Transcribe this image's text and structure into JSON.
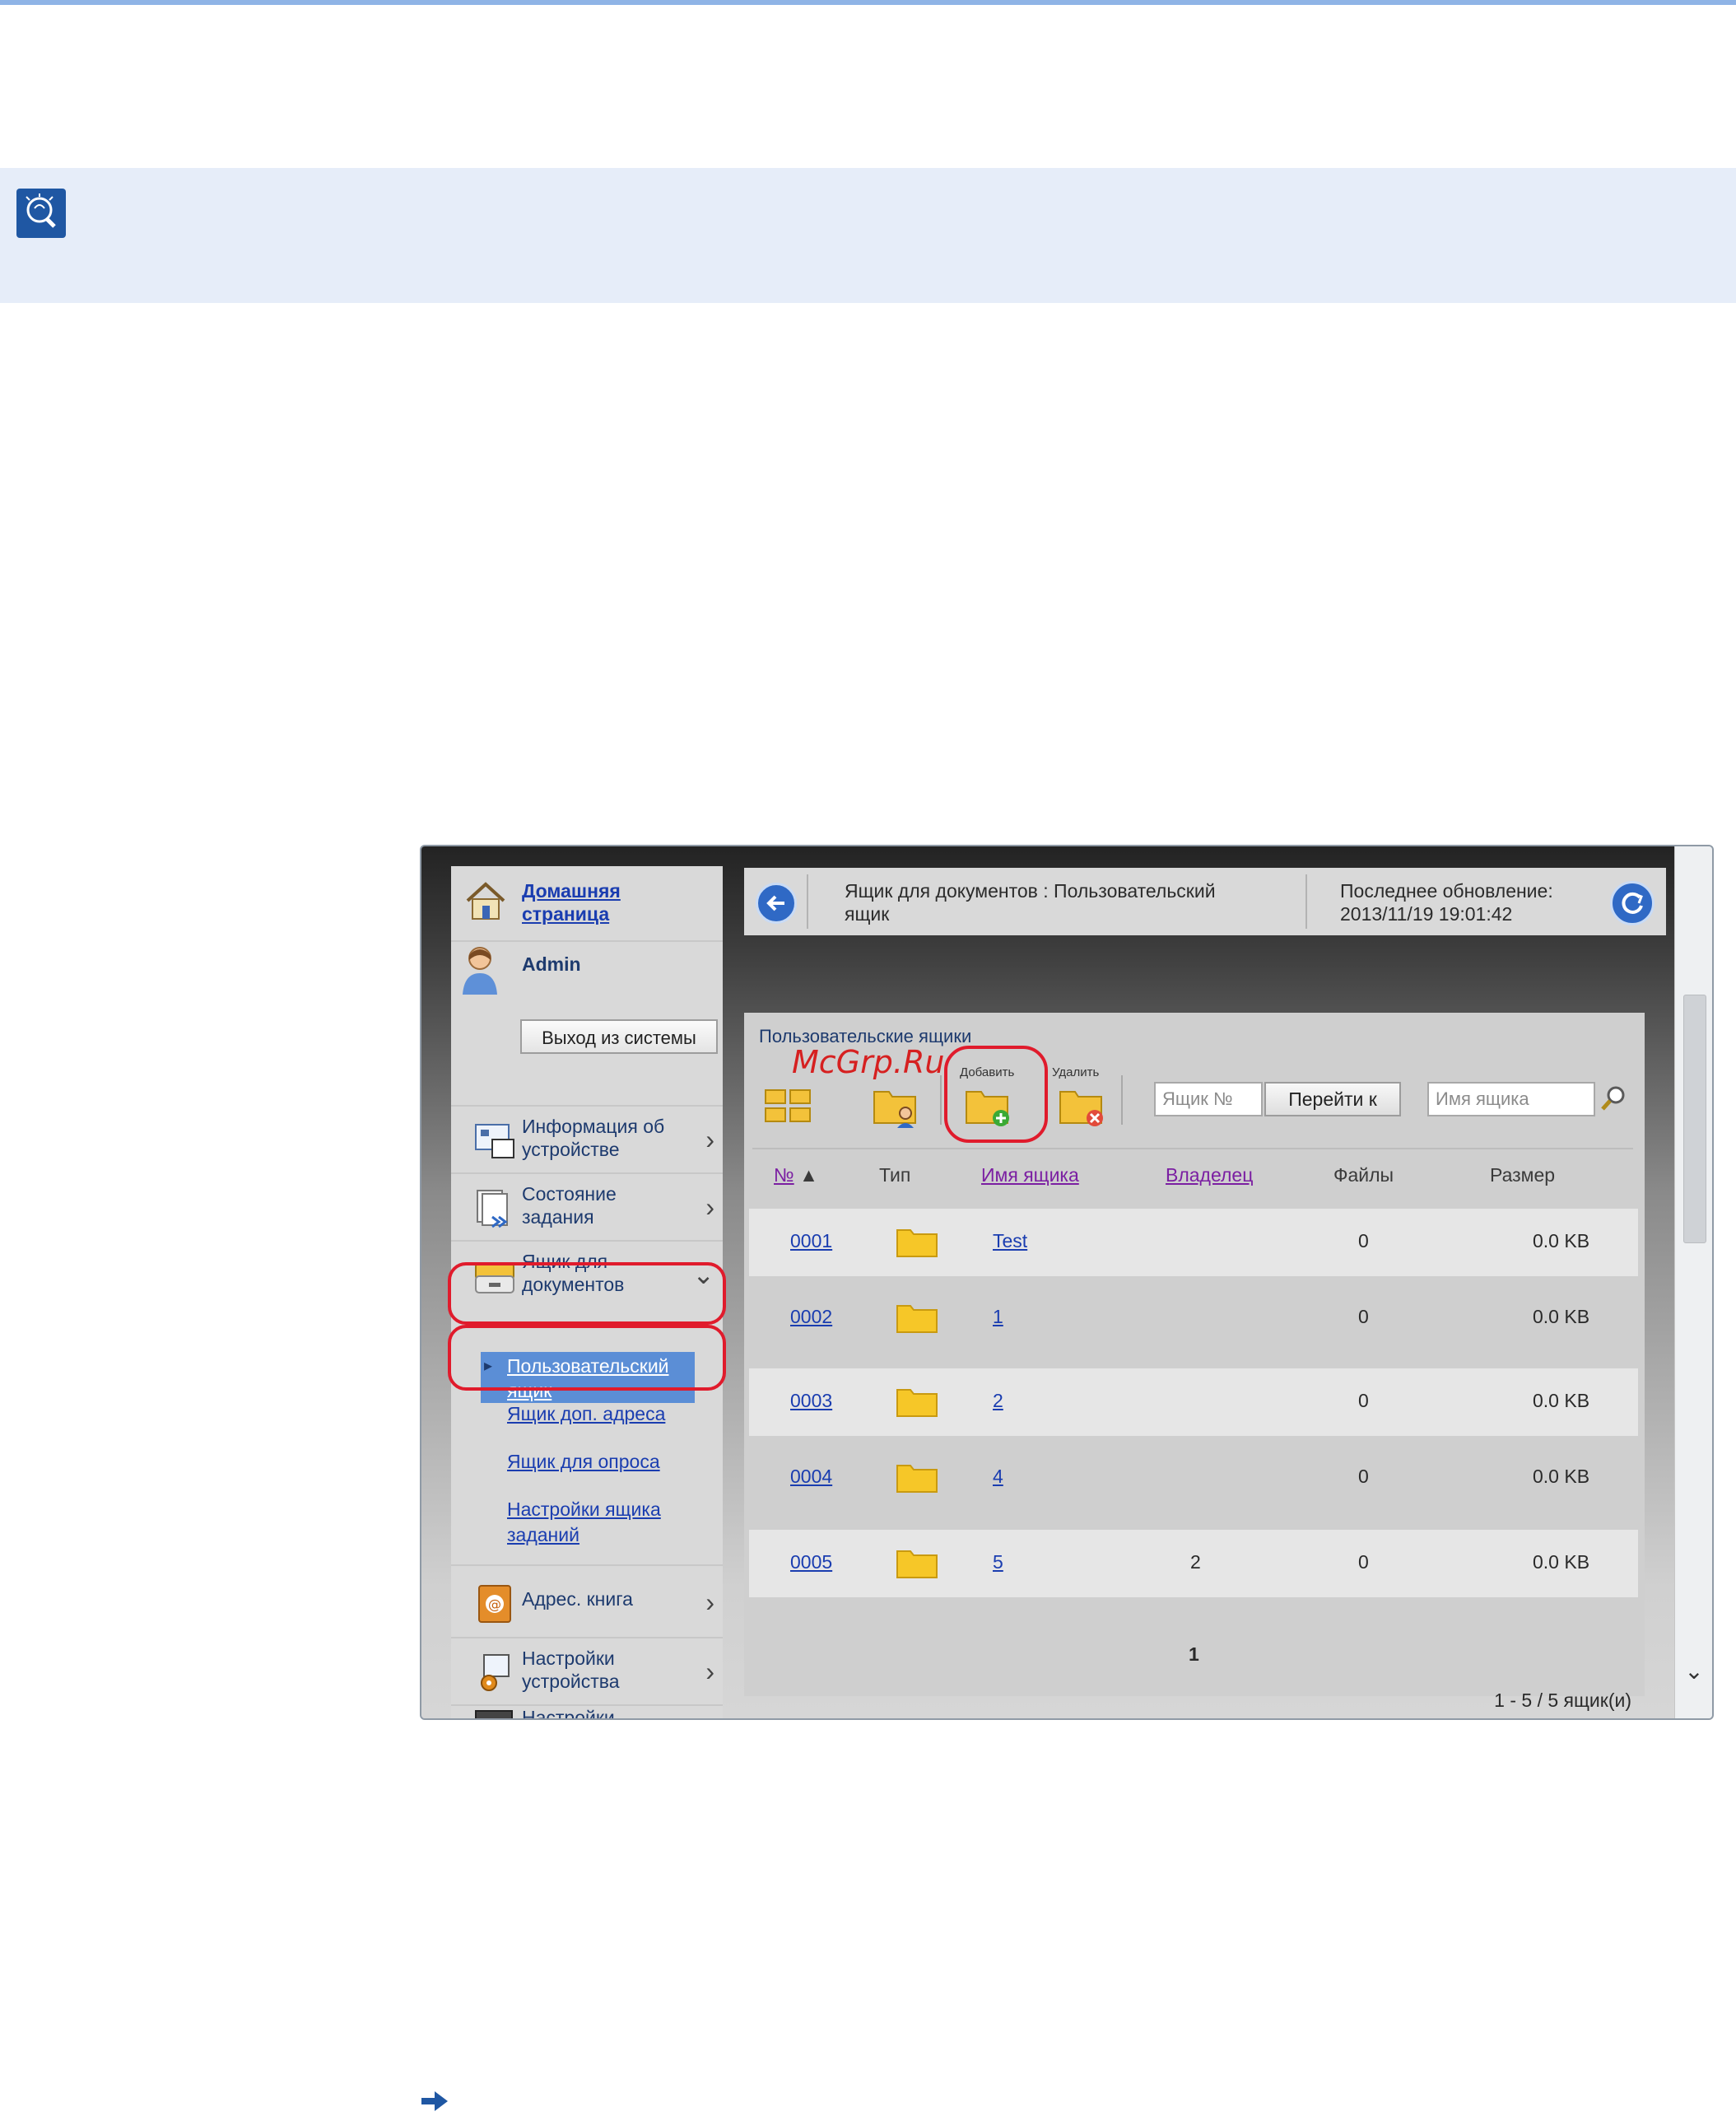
{
  "app": {
    "header": {
      "title": "Ящик для документов : Пользовательский ящик",
      "last_update_label": "Последнее обновление:",
      "last_update_value": "2013/11/19 19:01:42"
    },
    "sidebar": {
      "home_link": "Домашняя страница",
      "user_name": "Admin",
      "logout_label": "Выход из системы",
      "items": [
        {
          "label": "Информация об устройстве",
          "icon": "device-info-icon"
        },
        {
          "label": "Состояние задания",
          "icon": "job-status-icon"
        },
        {
          "label": "Ящик для документов",
          "icon": "document-box-icon"
        },
        {
          "label": "Адрес. книга",
          "icon": "address-book-icon"
        },
        {
          "label": "Настройки устройства",
          "icon": "device-settings-icon"
        },
        {
          "label": "Настройки",
          "icon": "settings-icon"
        }
      ],
      "subitems": [
        {
          "label": "Пользовательский ящик",
          "active": true
        },
        {
          "label": "Ящик доп. адреса"
        },
        {
          "label": "Ящик для опроса"
        },
        {
          "label": "Настройки ящика заданий"
        }
      ]
    },
    "panel": {
      "title": "Пользовательские ящики",
      "watermark": "McGrp.Ru",
      "toolbar": {
        "add_label": "Добавить",
        "delete_label": "Удалить",
        "box_number_placeholder": "Ящик №",
        "goto_label": "Перейти к",
        "box_name_placeholder": "Имя ящика"
      },
      "columns": {
        "number": "№",
        "type": "Тип",
        "name": "Имя ящика",
        "owner": "Владелец",
        "files": "Файлы",
        "size": "Размер"
      },
      "rows": [
        {
          "number": "0001",
          "name": "Test",
          "owner": "",
          "files": "0",
          "size": "0.0 KB"
        },
        {
          "number": "0002",
          "name": "1",
          "owner": "",
          "files": "0",
          "size": "0.0 KB"
        },
        {
          "number": "0003",
          "name": "2",
          "owner": "",
          "files": "0",
          "size": "0.0 KB"
        },
        {
          "number": "0004",
          "name": "4",
          "owner": "",
          "files": "0",
          "size": "0.0 KB"
        },
        {
          "number": "0005",
          "name": "5",
          "owner": "2",
          "files": "0",
          "size": "0.0 KB"
        }
      ],
      "page": "1",
      "count_text": "1 - 5 / 5 ящик(и)"
    }
  },
  "colors": {
    "accent": "#2f69c5",
    "highlight_ring": "#e01b2c",
    "note_band": "#e6edf9",
    "active_item": "#5b8ed6"
  }
}
